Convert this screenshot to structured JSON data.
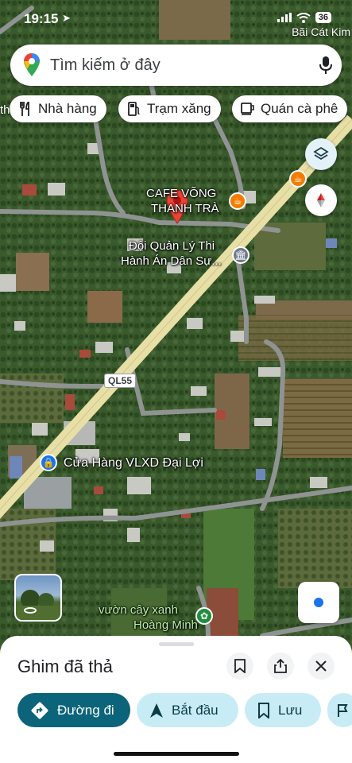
{
  "status_bar": {
    "time": "19:15",
    "battery": "36",
    "back_app": "Bãi Cát Kim"
  },
  "search": {
    "placeholder": "Tìm kiếm ở đây",
    "logo_icon": "google-maps-pin-icon",
    "mic_icon": "microphone-icon"
  },
  "chips": [
    {
      "label": "Nhà hàng",
      "icon": "fork-knife-icon"
    },
    {
      "label": "Trạm xăng",
      "icon": "gas-station-icon"
    },
    {
      "label": "Quán cà phê",
      "icon": "coffee-cup-icon"
    },
    {
      "label": "th",
      "icon": ""
    }
  ],
  "map": {
    "places": {
      "cafe_line1": "CAFE VÕNG",
      "cafe_line2": "THANH TRÀ",
      "office_line1": "Đội Quản Lý Thi",
      "office_line2": "Hành Án Dân Sự...",
      "road_badge": "QL55",
      "store": "Cửa Hàng VLXD Đại Lợi",
      "garden_line1": "vườn cây xanh",
      "garden_line2": "Hoàng Minh"
    },
    "colors": {
      "road": "#e8dfa6",
      "pin": "#ea4335",
      "cafe_poi": "#f57c00",
      "office_poi": "#6c7a89",
      "store_poi": "#1a73e8",
      "garden_poi": "#1e8e3e"
    }
  },
  "sheet": {
    "title": "Ghim đã thả",
    "actions": [
      {
        "label": "Đường đi",
        "icon": "directions-icon"
      },
      {
        "label": "Bắt đầu",
        "icon": "navigation-arrow-icon"
      },
      {
        "label": "Lưu",
        "icon": "bookmark-icon"
      }
    ]
  }
}
